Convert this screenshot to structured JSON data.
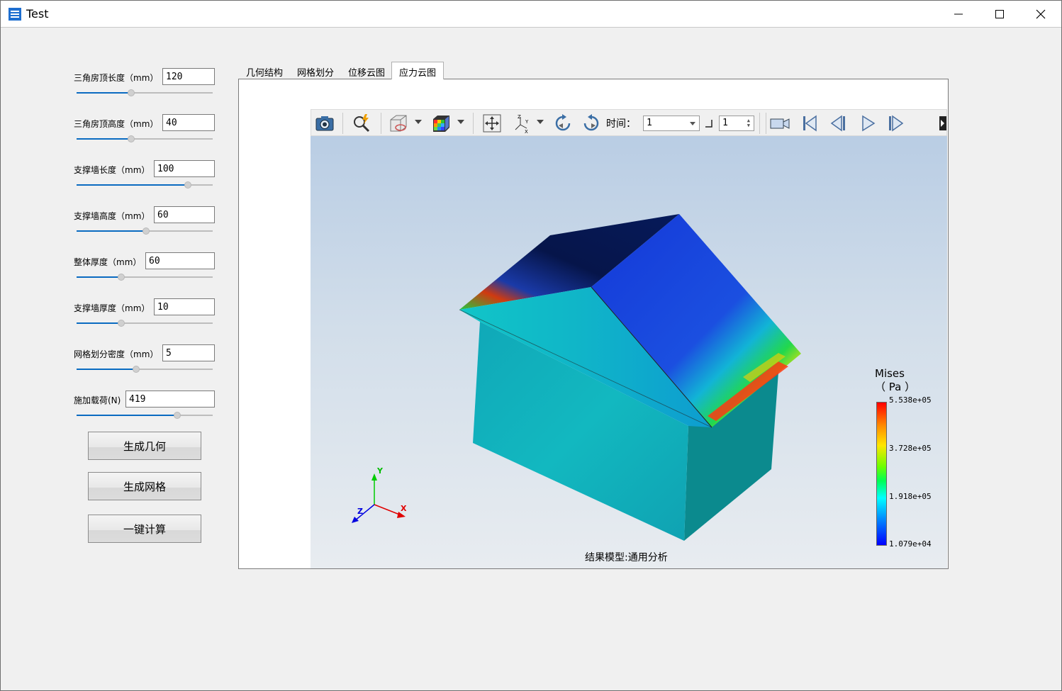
{
  "window": {
    "title": "Test"
  },
  "params": [
    {
      "label": "三角房顶长度（mm）",
      "value": "120",
      "slider": 0.4
    },
    {
      "label": "三角房顶高度（mm）",
      "value": "40",
      "slider": 0.4
    },
    {
      "label": "支撑墙长度（mm）",
      "value": "100",
      "slider": 0.82
    },
    {
      "label": "支撑墙高度（mm）",
      "value": "60",
      "slider": 0.51
    },
    {
      "label": "整体厚度（mm）",
      "value": "60",
      "slider": 0.33
    },
    {
      "label": "支撑墙厚度（mm）",
      "value": "10",
      "slider": 0.33
    },
    {
      "label": "网格划分密度（mm）",
      "value": "5",
      "slider": 0.44
    },
    {
      "label": "施加载荷(N)",
      "value": "419",
      "slider": 0.74
    }
  ],
  "buttons": {
    "generate_geometry": "生成几何",
    "generate_mesh": "生成网格",
    "one_click_compute": "一键计算"
  },
  "tabs": [
    {
      "label": "几何结构",
      "active": false
    },
    {
      "label": "网格划分",
      "active": false
    },
    {
      "label": "位移云图",
      "active": false
    },
    {
      "label": "应力云图",
      "active": true
    }
  ],
  "toolbar": {
    "icons": [
      "camera-icon",
      "query-icon",
      "display-mode-icon",
      "contour-icon",
      "fit-view-icon",
      "axes-icon",
      "rotate-cw-icon",
      "rotate-ccw-icon",
      "record-icon",
      "first-frame-icon",
      "prev-frame-icon",
      "play-icon",
      "next-frame-icon"
    ],
    "time_label": "时间：",
    "time_value": "1",
    "step_value": "1"
  },
  "viewer": {
    "model_caption": "结果模型:通用分析",
    "axes": {
      "x": "X",
      "y": "Y",
      "z": "Z"
    }
  },
  "legend": {
    "title": "Mises",
    "unit": "（ Pa ）",
    "values": [
      "5.538e+05",
      "3.728e+05",
      "1.918e+05",
      "1.079e+04"
    ],
    "colors": [
      "#ff0000",
      "#ffe600",
      "#00ff55",
      "#00ffff",
      "#0000ff"
    ]
  }
}
